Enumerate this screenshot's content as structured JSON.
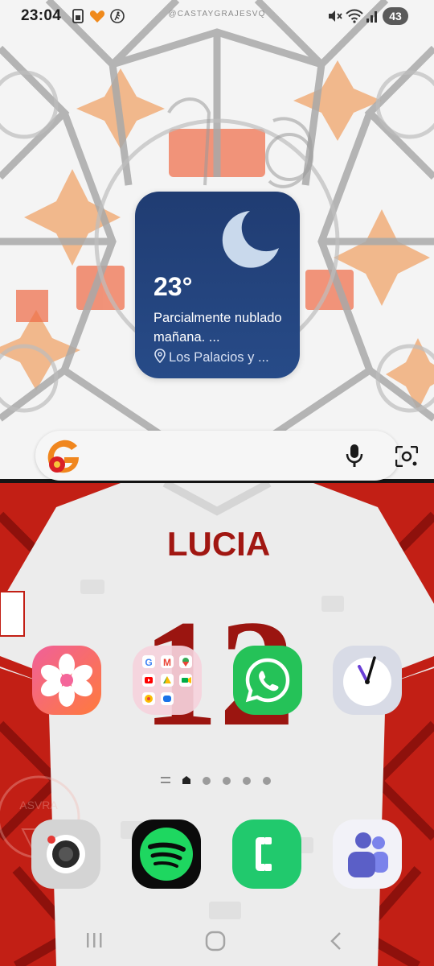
{
  "status_bar": {
    "time": "23:04",
    "watermark": "@CASTAYGRAJESVQ",
    "battery": "43",
    "left_icons": [
      "sim-card-icon",
      "heart-icon",
      "running-icon"
    ],
    "right_icons": [
      "mute-icon",
      "wifi-icon",
      "signal-icon"
    ]
  },
  "weather_widget": {
    "temperature": "23°",
    "condition": "Parcialmente nublado mañana. ...",
    "location": "Los Palacios y ...",
    "icon": "moon-icon",
    "background": "#203c72"
  },
  "search_bar": {
    "logo": "g-logo",
    "icons": [
      "mic-icon",
      "camera-lens-icon"
    ]
  },
  "wallpaper": {
    "jersey_name": "LUCIA",
    "jersey_number": "12",
    "watermark_text": "ASVRA"
  },
  "home_apps": [
    {
      "name": "Gallery",
      "icon": "flower-icon",
      "color": "#e83d7a"
    },
    {
      "name": "Google folder",
      "icon": "folder-icon",
      "color": "#f0c8d4"
    },
    {
      "name": "WhatsApp",
      "icon": "whatsapp-icon",
      "color": "#23c55e"
    },
    {
      "name": "Clock",
      "icon": "clock-icon",
      "color": "#d8dbe6"
    }
  ],
  "page_indicator": {
    "pages": 5,
    "current": 0
  },
  "dock_apps": [
    {
      "name": "Camera",
      "icon": "camera-icon",
      "color": "#d7d7d7"
    },
    {
      "name": "Spotify",
      "icon": "spotify-icon",
      "color": "#1db954"
    },
    {
      "name": "Phone",
      "icon": "phone-icon",
      "color": "#1ec46a"
    },
    {
      "name": "Teams",
      "icon": "teams-icon",
      "color": "#f1f1f7"
    }
  ],
  "nav_bar": [
    "recents-icon",
    "home-icon",
    "back-icon"
  ]
}
